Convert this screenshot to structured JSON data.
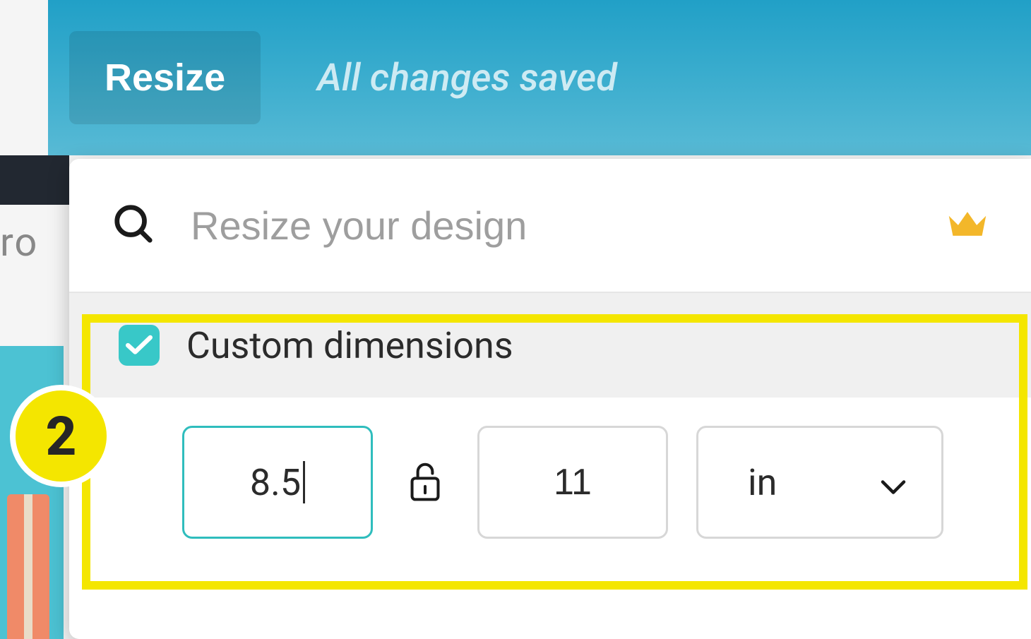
{
  "header": {
    "resize_label": "Resize",
    "saved_status": "All changes saved"
  },
  "left_fragment": "ro",
  "search": {
    "placeholder": "Resize your design",
    "icon": "search-icon",
    "premium_icon": "crown-icon"
  },
  "custom": {
    "label": "Custom dimensions",
    "checked": true
  },
  "dimensions": {
    "width": "8.5",
    "height": "11",
    "unit": "in",
    "lock": "unlocked"
  },
  "annotation": {
    "step_number": "2",
    "highlight_color": "#f4e600"
  }
}
